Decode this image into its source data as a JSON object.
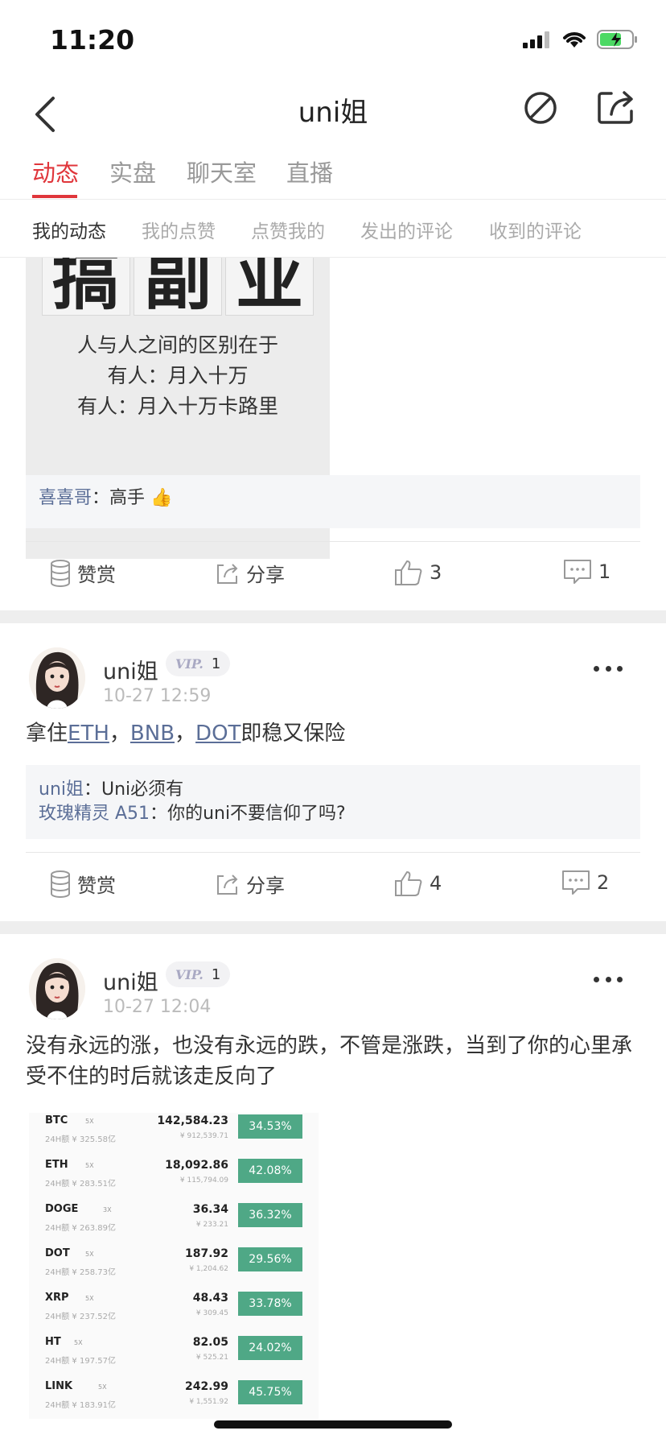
{
  "status_bar": {
    "time": "11:20"
  },
  "header": {
    "title": "uni姐"
  },
  "tabs": [
    {
      "label": "动态",
      "active": true
    },
    {
      "label": "实盘",
      "active": false
    },
    {
      "label": "聊天室",
      "active": false
    },
    {
      "label": "直播",
      "active": false
    }
  ],
  "subtabs": [
    {
      "label": "我的动态",
      "active": true
    },
    {
      "label": "我的点赞",
      "active": false
    },
    {
      "label": "点赞我的",
      "active": false
    },
    {
      "label": "发出的评论",
      "active": false
    },
    {
      "label": "收到的评论",
      "active": false
    }
  ],
  "colors": {
    "accent": "#e0363b",
    "link": "#5b6e97",
    "gain": "#4fa886"
  },
  "post1": {
    "image": {
      "big_chars": [
        "搞",
        "副",
        "业"
      ],
      "lines": [
        "人与人之间的区别在于",
        "有人：月入十万",
        "有人：月入十万卡路里"
      ]
    },
    "comments": [
      {
        "user": "喜喜哥",
        "sep": "：",
        "text": "高手 👍"
      }
    ],
    "actions": {
      "reward": "赞赏",
      "share": "分享",
      "likes": "3",
      "comments": "1"
    }
  },
  "post2": {
    "user": "uni姐",
    "vip": "VIP.",
    "level": "1",
    "time": "10-27 12:59",
    "text_prefix": "拿住",
    "coin1": "ETH",
    "sep1": "，",
    "coin2": "BNB",
    "sep2": "，",
    "coin3": "DOT",
    "text_suffix": "即稳又保险",
    "comments": [
      {
        "user": "uni姐",
        "sep": "：",
        "text": "Uni必须有"
      },
      {
        "user": "玫瑰精灵 A51",
        "sep": "：",
        "text": "你的uni不要信仰了吗?"
      }
    ],
    "actions": {
      "reward": "赞赏",
      "share": "分享",
      "likes": "4",
      "comments": "2"
    }
  },
  "post3": {
    "user": "uni姐",
    "vip": "VIP.",
    "level": "1",
    "time": "10-27 12:04",
    "text": "没有永远的涨，也没有永远的跌，不管是涨跌，当到了你的心里承受不住的时后就该走反向了",
    "market": [
      {
        "name": "BTC",
        "lev": "5X",
        "vol": "24H额 ¥ 325.58亿",
        "price": "142,584.23",
        "cny": "¥ 912,539.71",
        "change": "34.53%"
      },
      {
        "name": "ETH",
        "lev": "5X",
        "vol": "24H额 ¥ 283.51亿",
        "price": "18,092.86",
        "cny": "¥ 115,794.09",
        "change": "42.08%"
      },
      {
        "name": "DOGE",
        "lev": "3X",
        "vol": "24H额 ¥ 263.89亿",
        "price": "36.34",
        "cny": "¥ 233.21",
        "change": "36.32%"
      },
      {
        "name": "DOT",
        "lev": "5X",
        "vol": "24H额 ¥ 258.73亿",
        "price": "187.92",
        "cny": "¥ 1,204.62",
        "change": "29.56%"
      },
      {
        "name": "XRP",
        "lev": "5X",
        "vol": "24H额 ¥ 237.52亿",
        "price": "48.43",
        "cny": "¥ 309.45",
        "change": "33.78%"
      },
      {
        "name": "HT",
        "lev": "5X",
        "vol": "24H额 ¥ 197.57亿",
        "price": "82.05",
        "cny": "¥ 525.21",
        "change": "24.02%"
      },
      {
        "name": "LINK",
        "lev": "5X",
        "vol": "24H额 ¥ 183.91亿",
        "price": "242.99",
        "cny": "¥ 1,551.92",
        "change": "45.75%"
      }
    ]
  }
}
